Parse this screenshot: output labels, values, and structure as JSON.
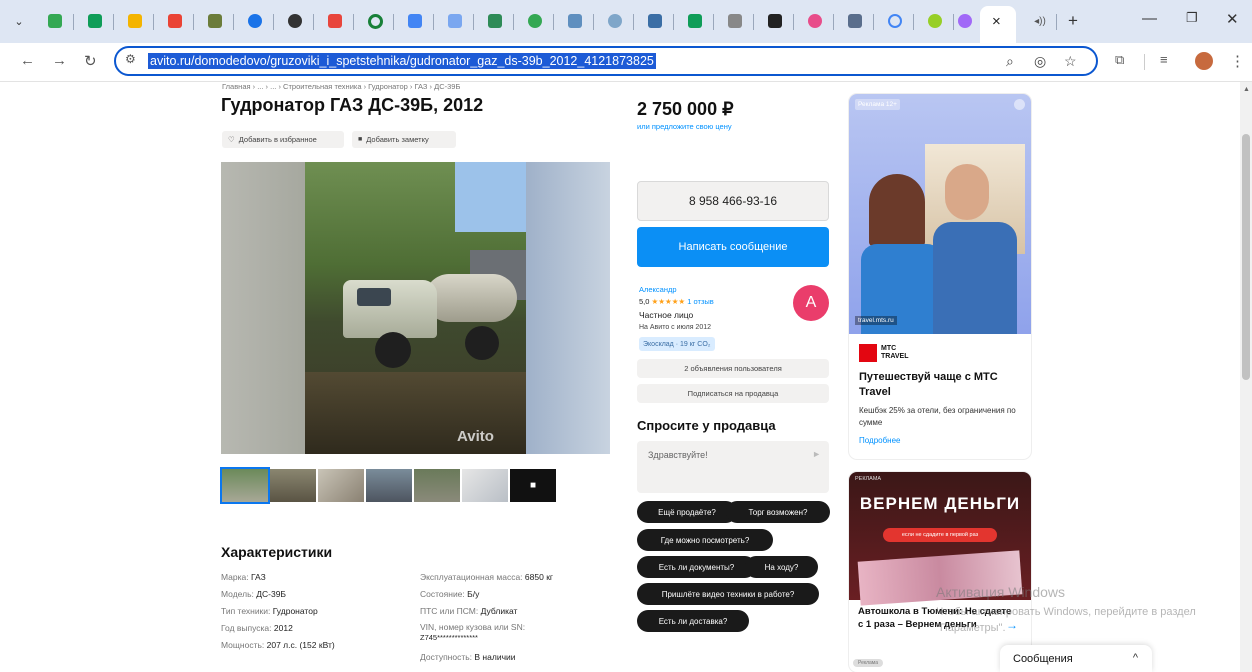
{
  "browser": {
    "url": "avito.ru/domodedovo/gruzoviki_i_spetstehnika/gudronator_gaz_ds-39b_2012_4121873825",
    "tab_close": "×",
    "new_tab": "+",
    "tab_audio": "◂))"
  },
  "colors": {
    "accent_blue": "#0b77ef",
    "link_blue": "#0091ff",
    "avatar_pink": "#ea3d6b",
    "tab_bg": "#dee6f3"
  },
  "breadcrumb": "Главная › ... › ... › Строительная техника › Гудронатор › ГАЗ › ДС-39Б",
  "listing": {
    "title": "Гудронатор ГАЗ ДС-39Б, 2012",
    "favorite": "Добавить в избранное",
    "note": "Добавить заметку",
    "watermark": "Avito"
  },
  "characteristics": {
    "heading": "Характеристики",
    "left": [
      {
        "k": "Марка:",
        "v": "ГАЗ"
      },
      {
        "k": "Модель:",
        "v": "ДС-39Б"
      },
      {
        "k": "Тип техники:",
        "v": "Гудронатор"
      },
      {
        "k": "Год выпуска:",
        "v": "2012"
      },
      {
        "k": "Мощность:",
        "v": "207 л.с. (152 кВт)"
      }
    ],
    "right": [
      {
        "k": "Эксплуатационная масса:",
        "v": "6850 кг"
      },
      {
        "k": "Состояние:",
        "v": "Б/у"
      },
      {
        "k": "ПТС или ПСМ:",
        "v": "Дубликат"
      },
      {
        "k": "VIN, номер кузова или SN:",
        "v": ""
      },
      {
        "k": "",
        "v": "Z745**************"
      },
      {
        "k": "Доступность:",
        "v": "В наличии"
      }
    ]
  },
  "seller": {
    "price": "2 750 000 ₽",
    "price_link": "или предложите свою цену",
    "phone": "8 958 466-93-16",
    "write_button": "Написать сообщение",
    "name": "Александр",
    "rating": "5,0",
    "stars": "★★★★★",
    "reviews": "1 отзыв",
    "type": "Частное лицо",
    "since": "На Авито с июля 2012",
    "badge": "Экосклад · 19 кг CO₂",
    "avatar_letter": "А",
    "ads_button": "2 объявления пользователя",
    "subscribe_button": "Подписаться на продавца"
  },
  "ask": {
    "heading": "Спросите у продавца",
    "placeholder": "Здравствуйте!",
    "send_icon": "►",
    "questions": [
      "Ещё продаёте?",
      "Торг возможен?",
      "Где можно посмотреть?",
      "Есть ли документы?",
      "На ходу?",
      "Пришлёте видео техники в работе?",
      "Есть ли доставка?"
    ]
  },
  "ad1": {
    "label": "Реклама",
    "age": "12+",
    "domain": "travel.mts.ru",
    "logo_line1": "МТС",
    "logo_line2": "TRAVEL",
    "title": "Путешествуй чаще с МТС Travel",
    "text": "Кешбэк 25% за отели, без ограничения по сумме",
    "link": "Подробнее"
  },
  "ad2": {
    "label": "РЕКЛАМА",
    "headline": "ВЕРНЕМ ДЕНЬГИ",
    "subline": "если не сдадите в первой раз",
    "title": "Автошкола в Тюмени: Не сдаете с 1 раза – Вернем деньги",
    "tag": "Реклама"
  },
  "overlay": {
    "activate_title": "Активация Windows",
    "activate_text": "Чтобы активировать Windows, перейдите в раздел \"Параметры\".",
    "messages": "Сообщения",
    "messages_chevron": "^"
  }
}
